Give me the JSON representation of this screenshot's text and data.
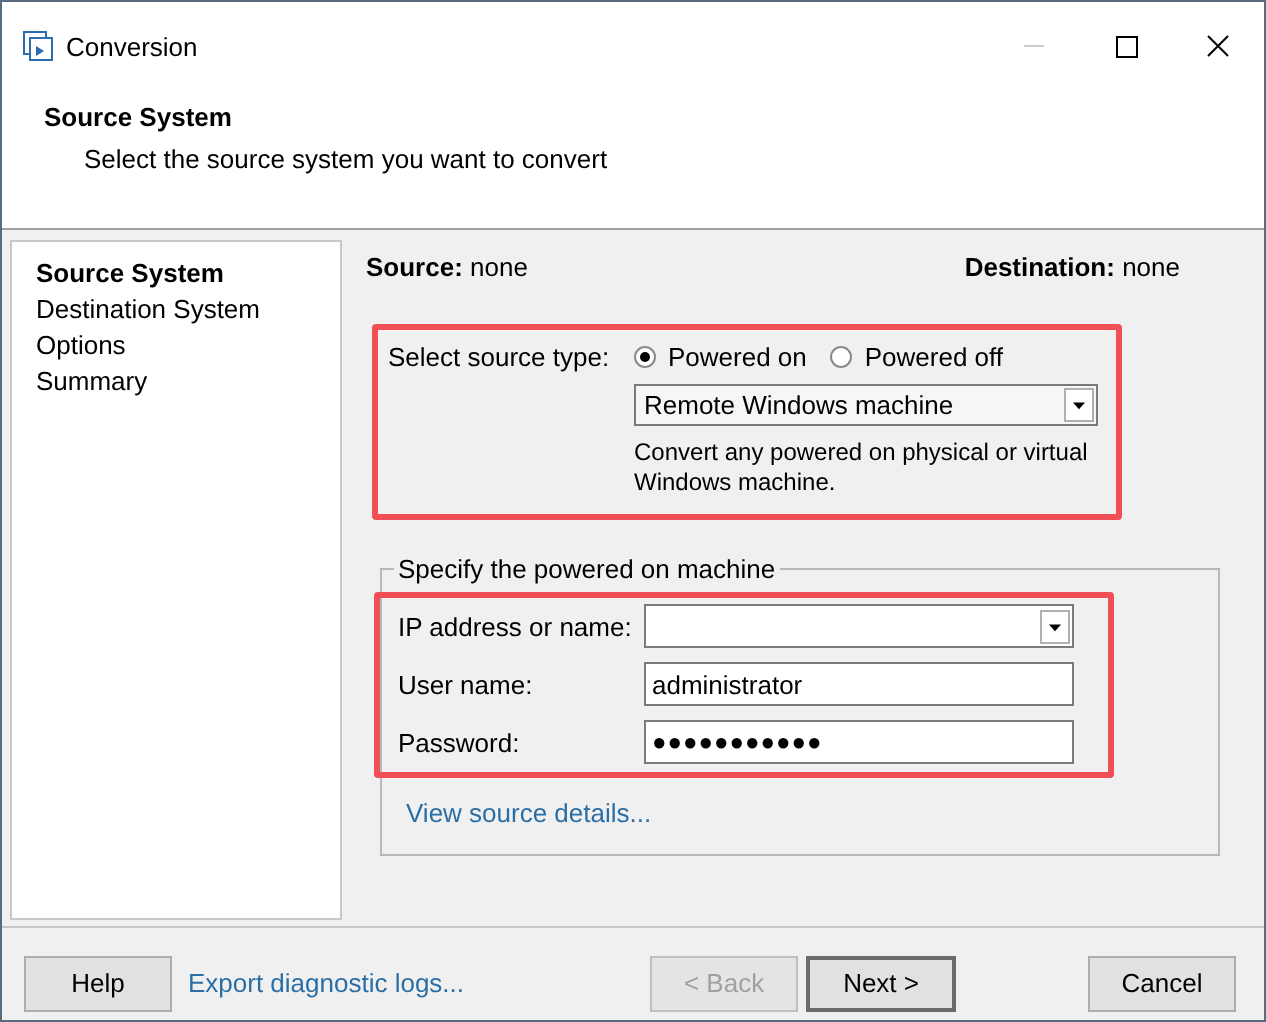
{
  "window": {
    "title": "Conversion"
  },
  "header": {
    "title": "Source System",
    "subtitle": "Select the source system you want to convert"
  },
  "sidebar": {
    "items": [
      {
        "label": "Source System",
        "selected": true
      },
      {
        "label": "Destination System",
        "selected": false
      },
      {
        "label": "Options",
        "selected": false
      },
      {
        "label": "Summary",
        "selected": false
      }
    ]
  },
  "summary": {
    "source_label": "Source:",
    "source_value": "none",
    "destination_label": "Destination:",
    "destination_value": "none"
  },
  "source_type": {
    "label": "Select source type:",
    "options": [
      {
        "label": "Powered on",
        "selected": true
      },
      {
        "label": "Powered off",
        "selected": false
      }
    ],
    "machine_type": "Remote Windows machine",
    "description": "Convert any powered on physical or virtual Windows machine."
  },
  "machine_group": {
    "legend": "Specify the powered on machine",
    "ip_label": "IP address or name:",
    "user_label": "User name:",
    "user_value": "administrator",
    "password_label": "Password:",
    "password_value": "●●●●●●●●●●●",
    "details_link": "View source details..."
  },
  "footer": {
    "help": "Help",
    "export_link": "Export diagnostic logs...",
    "buttons": [
      {
        "label": "< Back",
        "disabled": true,
        "default": false
      },
      {
        "label": "Next >",
        "disabled": false,
        "default": true
      }
    ],
    "cancel": "Cancel"
  }
}
